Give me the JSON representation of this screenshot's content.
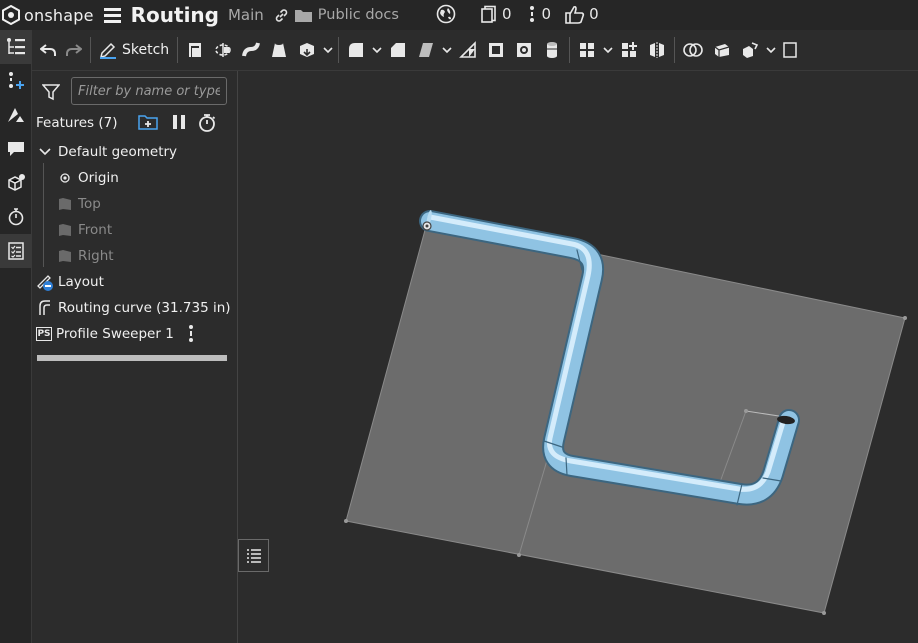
{
  "app": {
    "logo_text": "onshape",
    "doc_title": "Routing",
    "branch": "Main",
    "folder": "Public docs"
  },
  "stats": {
    "versions": "0",
    "comments": "0",
    "likes": "0"
  },
  "toolbar": {
    "sketch_label": "Sketch"
  },
  "feature_panel": {
    "filter_placeholder": "Filter by name or type",
    "features_header": "Features (7)",
    "default_geometry": "Default geometry",
    "origin": "Origin",
    "planes": [
      "Top",
      "Front",
      "Right"
    ],
    "features": [
      {
        "label": "Layout",
        "icon": "layout-icon"
      },
      {
        "label": "Routing curve (31.735 in)",
        "icon": "routing-curve-icon"
      },
      {
        "label": "Profile Sweeper 1",
        "icon": "ps-icon",
        "badge": "PS"
      }
    ]
  },
  "colors": {
    "background": "#2c2c2c",
    "plane_fill": "#6c6c6c",
    "pipe": "#9ccbe8"
  }
}
